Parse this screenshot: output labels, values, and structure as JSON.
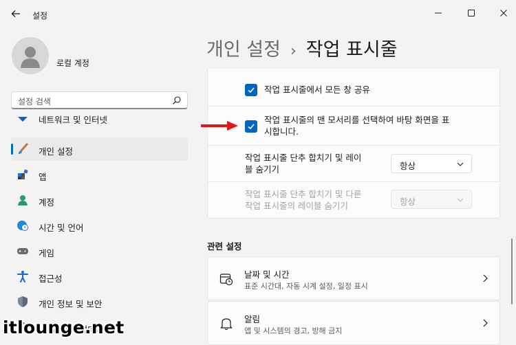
{
  "window": {
    "title": "설정"
  },
  "profile": {
    "name": "로컬 계정"
  },
  "search": {
    "placeholder": "설정 검색"
  },
  "sidebar": {
    "items": [
      {
        "label": "네트워크 및 인터넷",
        "icon": "network-icon",
        "active": false
      },
      {
        "label": "개인 설정",
        "icon": "brush-icon",
        "active": true
      },
      {
        "label": "앱",
        "icon": "apps-icon",
        "active": false
      },
      {
        "label": "계정",
        "icon": "account-icon",
        "active": false
      },
      {
        "label": "시간 및 언어",
        "icon": "globe-clock-icon",
        "active": false
      },
      {
        "label": "게임",
        "icon": "gamepad-icon",
        "active": false
      },
      {
        "label": "접근성",
        "icon": "accessibility-icon",
        "active": false
      },
      {
        "label": "개인 정보 및 보안",
        "icon": "shield-icon",
        "active": false
      },
      {
        "label": "Windows 업데이트",
        "icon": "update-icon",
        "active": false
      }
    ]
  },
  "breadcrumb": {
    "parent": "개인 설정",
    "separator": "›",
    "current": "작업 표시줄"
  },
  "behaviors": {
    "share_any_window": {
      "label": "작업 표시줄에서 모든 창 공유",
      "checked": true
    },
    "corner_show_desktop": {
      "label_line1": "작업 표시줄의 맨 모서리를 선택하여 바탕 화면을 표",
      "label_line2": "시합니다.",
      "checked": true
    },
    "combine_buttons": {
      "label_line1": "작업 표시줄 단추 합치기 및 레이",
      "label_line2": "블 숨기기",
      "value": "항상"
    },
    "combine_other": {
      "label_line1": "작업 표시줄 단추 합치기 및 다른",
      "label_line2": "작업 표시줄의 레이블 숨기기",
      "value": "항상",
      "disabled": true
    }
  },
  "related": {
    "title": "관련 설정",
    "items": [
      {
        "title": "날짜 및 시간",
        "subtitle": "표준 시간대, 자동 시계 설정, 일정 표시",
        "icon": "calendar-clock-icon"
      },
      {
        "title": "알림",
        "subtitle": "앱 및 시스템의 경고, 방해 금지",
        "icon": "bell-icon"
      }
    ]
  },
  "watermark": "itlounge.net",
  "colors": {
    "accent": "#0067c0",
    "arrow": "#e0161b",
    "background": "#f3f3f3"
  }
}
